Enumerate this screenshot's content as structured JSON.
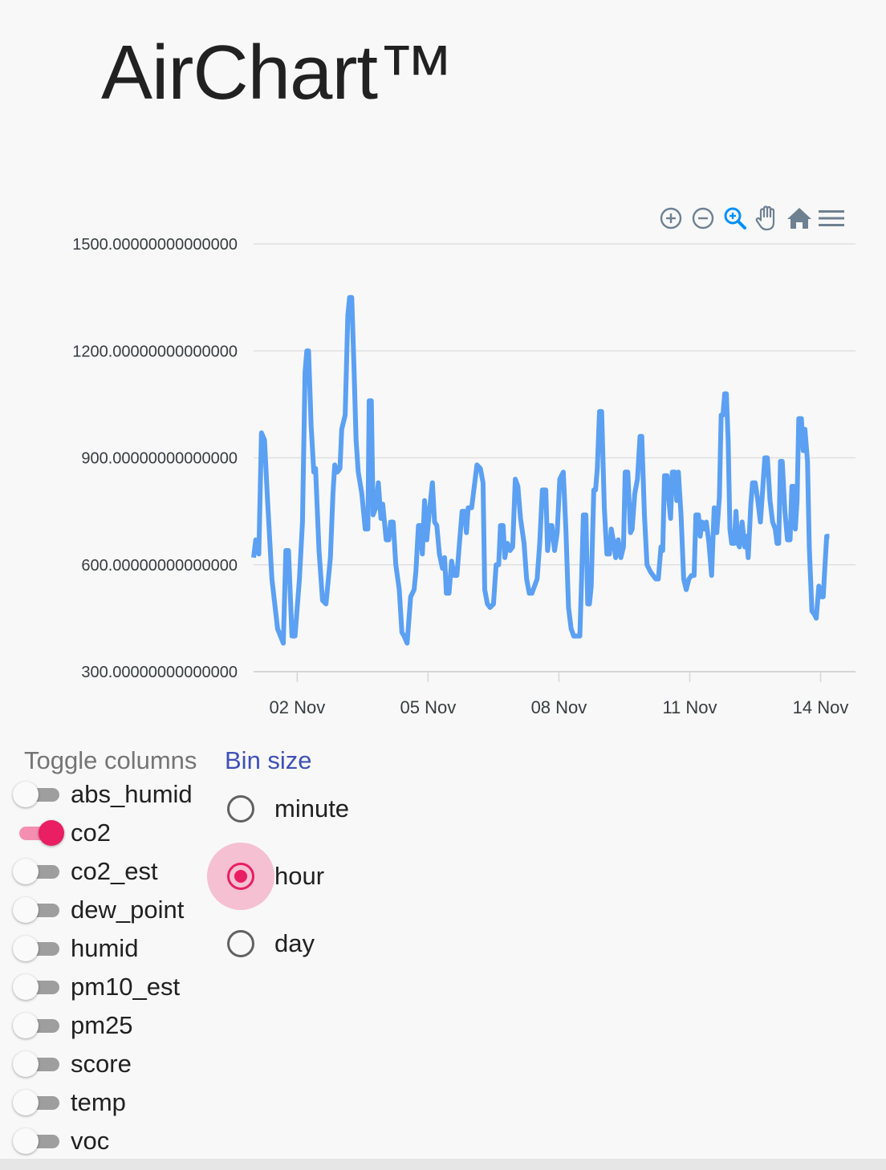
{
  "app": {
    "title": "AirChart™"
  },
  "toolbar": {
    "icons": [
      "zoom-in-icon",
      "zoom-out-icon",
      "selection-zoom-icon",
      "pan-icon",
      "reset-home-icon",
      "menu-icon"
    ],
    "active_color": "#008ffb",
    "inactive_color": "#6e8192"
  },
  "chart_data": {
    "type": "line",
    "title": "",
    "xlabel": "",
    "ylabel": "",
    "x_tick_labels": [
      "02 Nov",
      "05 Nov",
      "08 Nov",
      "11 Nov",
      "14 Nov"
    ],
    "x_tick_days": [
      2,
      5,
      8,
      11,
      14
    ],
    "x_range_days": [
      1.0,
      14.8
    ],
    "y_tick_labels": [
      "1500.00000000000000",
      "1200.00000000000000",
      "900.00000000000000",
      "600.00000000000000",
      "300.00000000000000"
    ],
    "ylim": [
      300,
      1500
    ],
    "grid": true,
    "series": [
      {
        "color": "#5ba0f2",
        "points": [
          [
            1.0,
            620
          ],
          [
            1.05,
            670
          ],
          [
            1.12,
            630
          ],
          [
            1.18,
            970
          ],
          [
            1.25,
            950
          ],
          [
            1.32,
            780
          ],
          [
            1.42,
            560
          ],
          [
            1.55,
            420
          ],
          [
            1.68,
            380
          ],
          [
            1.74,
            640
          ],
          [
            1.8,
            640
          ],
          [
            1.88,
            400
          ],
          [
            1.95,
            400
          ],
          [
            2.05,
            560
          ],
          [
            2.12,
            720
          ],
          [
            2.18,
            1140
          ],
          [
            2.22,
            1200
          ],
          [
            2.26,
            1200
          ],
          [
            2.32,
            990
          ],
          [
            2.38,
            860
          ],
          [
            2.42,
            870
          ],
          [
            2.5,
            640
          ],
          [
            2.58,
            500
          ],
          [
            2.66,
            490
          ],
          [
            2.76,
            620
          ],
          [
            2.82,
            800
          ],
          [
            2.86,
            880
          ],
          [
            2.92,
            860
          ],
          [
            2.98,
            870
          ],
          [
            3.02,
            980
          ],
          [
            3.1,
            1020
          ],
          [
            3.16,
            1300
          ],
          [
            3.2,
            1350
          ],
          [
            3.25,
            1350
          ],
          [
            3.3,
            1160
          ],
          [
            3.35,
            950
          ],
          [
            3.4,
            860
          ],
          [
            3.48,
            800
          ],
          [
            3.56,
            700
          ],
          [
            3.62,
            700
          ],
          [
            3.65,
            1060
          ],
          [
            3.7,
            1060
          ],
          [
            3.74,
            740
          ],
          [
            3.8,
            760
          ],
          [
            3.86,
            830
          ],
          [
            3.92,
            730
          ],
          [
            3.96,
            770
          ],
          [
            4.04,
            670
          ],
          [
            4.1,
            670
          ],
          [
            4.14,
            720
          ],
          [
            4.2,
            720
          ],
          [
            4.26,
            600
          ],
          [
            4.34,
            530
          ],
          [
            4.4,
            410
          ],
          [
            4.45,
            400
          ],
          [
            4.52,
            380
          ],
          [
            4.6,
            510
          ],
          [
            4.68,
            530
          ],
          [
            4.72,
            580
          ],
          [
            4.78,
            710
          ],
          [
            4.82,
            710
          ],
          [
            4.87,
            630
          ],
          [
            4.92,
            780
          ],
          [
            4.97,
            670
          ],
          [
            5.03,
            750
          ],
          [
            5.1,
            830
          ],
          [
            5.15,
            720
          ],
          [
            5.2,
            710
          ],
          [
            5.26,
            630
          ],
          [
            5.33,
            590
          ],
          [
            5.38,
            620
          ],
          [
            5.42,
            520
          ],
          [
            5.48,
            520
          ],
          [
            5.54,
            610
          ],
          [
            5.6,
            570
          ],
          [
            5.66,
            570
          ],
          [
            5.72,
            660
          ],
          [
            5.78,
            750
          ],
          [
            5.84,
            750
          ],
          [
            5.88,
            690
          ],
          [
            5.92,
            760
          ],
          [
            6.0,
            760
          ],
          [
            6.06,
            820
          ],
          [
            6.12,
            880
          ],
          [
            6.2,
            870
          ],
          [
            6.26,
            830
          ],
          [
            6.3,
            530
          ],
          [
            6.36,
            490
          ],
          [
            6.42,
            480
          ],
          [
            6.5,
            490
          ],
          [
            6.56,
            600
          ],
          [
            6.62,
            600
          ],
          [
            6.66,
            710
          ],
          [
            6.72,
            710
          ],
          [
            6.76,
            620
          ],
          [
            6.82,
            660
          ],
          [
            6.88,
            640
          ],
          [
            6.94,
            650
          ],
          [
            7.0,
            840
          ],
          [
            7.06,
            820
          ],
          [
            7.12,
            730
          ],
          [
            7.2,
            660
          ],
          [
            7.26,
            560
          ],
          [
            7.32,
            520
          ],
          [
            7.38,
            520
          ],
          [
            7.44,
            540
          ],
          [
            7.5,
            560
          ],
          [
            7.56,
            660
          ],
          [
            7.62,
            810
          ],
          [
            7.7,
            810
          ],
          [
            7.74,
            640
          ],
          [
            7.8,
            710
          ],
          [
            7.84,
            710
          ],
          [
            7.9,
            640
          ],
          [
            7.96,
            690
          ],
          [
            8.02,
            840
          ],
          [
            8.1,
            860
          ],
          [
            8.16,
            700
          ],
          [
            8.22,
            480
          ],
          [
            8.28,
            420
          ],
          [
            8.34,
            400
          ],
          [
            8.42,
            400
          ],
          [
            8.48,
            400
          ],
          [
            8.52,
            560
          ],
          [
            8.56,
            740
          ],
          [
            8.62,
            740
          ],
          [
            8.66,
            490
          ],
          [
            8.7,
            490
          ],
          [
            8.74,
            540
          ],
          [
            8.8,
            810
          ],
          [
            8.84,
            810
          ],
          [
            8.88,
            870
          ],
          [
            8.93,
            1030
          ],
          [
            8.98,
            1030
          ],
          [
            9.04,
            760
          ],
          [
            9.1,
            630
          ],
          [
            9.16,
            630
          ],
          [
            9.2,
            700
          ],
          [
            9.26,
            660
          ],
          [
            9.3,
            620
          ],
          [
            9.36,
            670
          ],
          [
            9.42,
            620
          ],
          [
            9.48,
            650
          ],
          [
            9.52,
            860
          ],
          [
            9.58,
            860
          ],
          [
            9.64,
            690
          ],
          [
            9.68,
            700
          ],
          [
            9.74,
            800
          ],
          [
            9.8,
            840
          ],
          [
            9.86,
            960
          ],
          [
            9.9,
            960
          ],
          [
            9.96,
            740
          ],
          [
            10.02,
            600
          ],
          [
            10.1,
            580
          ],
          [
            10.16,
            570
          ],
          [
            10.22,
            560
          ],
          [
            10.28,
            560
          ],
          [
            10.34,
            650
          ],
          [
            10.38,
            640
          ],
          [
            10.42,
            850
          ],
          [
            10.48,
            850
          ],
          [
            10.52,
            780
          ],
          [
            10.56,
            730
          ],
          [
            10.6,
            860
          ],
          [
            10.66,
            860
          ],
          [
            10.7,
            780
          ],
          [
            10.74,
            860
          ],
          [
            10.8,
            740
          ],
          [
            10.86,
            560
          ],
          [
            10.92,
            530
          ],
          [
            10.98,
            560
          ],
          [
            11.04,
            570
          ],
          [
            11.1,
            570
          ],
          [
            11.14,
            740
          ],
          [
            11.2,
            740
          ],
          [
            11.24,
            680
          ],
          [
            11.28,
            720
          ],
          [
            11.34,
            700
          ],
          [
            11.38,
            720
          ],
          [
            11.44,
            660
          ],
          [
            11.5,
            570
          ],
          [
            11.56,
            760
          ],
          [
            11.62,
            690
          ],
          [
            11.68,
            790
          ],
          [
            11.72,
            1020
          ],
          [
            11.76,
            1020
          ],
          [
            11.8,
            1080
          ],
          [
            11.84,
            1080
          ],
          [
            11.88,
            950
          ],
          [
            11.92,
            700
          ],
          [
            11.96,
            660
          ],
          [
            12.02,
            660
          ],
          [
            12.06,
            750
          ],
          [
            12.1,
            660
          ],
          [
            12.14,
            650
          ],
          [
            12.2,
            720
          ],
          [
            12.26,
            650
          ],
          [
            12.3,
            680
          ],
          [
            12.34,
            620
          ],
          [
            12.4,
            770
          ],
          [
            12.44,
            830
          ],
          [
            12.5,
            830
          ],
          [
            12.56,
            780
          ],
          [
            12.62,
            720
          ],
          [
            12.66,
            790
          ],
          [
            12.72,
            900
          ],
          [
            12.78,
            900
          ],
          [
            12.84,
            780
          ],
          [
            12.9,
            720
          ],
          [
            12.96,
            700
          ],
          [
            13.0,
            660
          ],
          [
            13.04,
            660
          ],
          [
            13.08,
            890
          ],
          [
            13.12,
            890
          ],
          [
            13.18,
            750
          ],
          [
            13.24,
            670
          ],
          [
            13.3,
            670
          ],
          [
            13.34,
            820
          ],
          [
            13.38,
            820
          ],
          [
            13.42,
            700
          ],
          [
            13.46,
            780
          ],
          [
            13.5,
            1010
          ],
          [
            13.56,
            1010
          ],
          [
            13.6,
            920
          ],
          [
            13.64,
            980
          ],
          [
            13.7,
            890
          ],
          [
            13.74,
            650
          ],
          [
            13.8,
            470
          ],
          [
            13.86,
            460
          ],
          [
            13.9,
            450
          ],
          [
            13.96,
            540
          ],
          [
            14.02,
            510
          ],
          [
            14.06,
            510
          ],
          [
            14.1,
            600
          ],
          [
            14.14,
            680
          ],
          [
            14.2,
            680
          ]
        ]
      }
    ]
  },
  "controls": {
    "toggle_title": "Toggle columns",
    "bin_title": "Bin size",
    "toggles": [
      {
        "label": "abs_humid",
        "on": false
      },
      {
        "label": "co2",
        "on": true
      },
      {
        "label": "co2_est",
        "on": false
      },
      {
        "label": "dew_point",
        "on": false
      },
      {
        "label": "humid",
        "on": false
      },
      {
        "label": "pm10_est",
        "on": false
      },
      {
        "label": "pm25",
        "on": false
      },
      {
        "label": "score",
        "on": false
      },
      {
        "label": "temp",
        "on": false
      },
      {
        "label": "voc",
        "on": false
      }
    ],
    "bins": [
      {
        "label": "minute",
        "checked": false
      },
      {
        "label": "hour",
        "checked": true
      },
      {
        "label": "day",
        "checked": false
      }
    ]
  }
}
